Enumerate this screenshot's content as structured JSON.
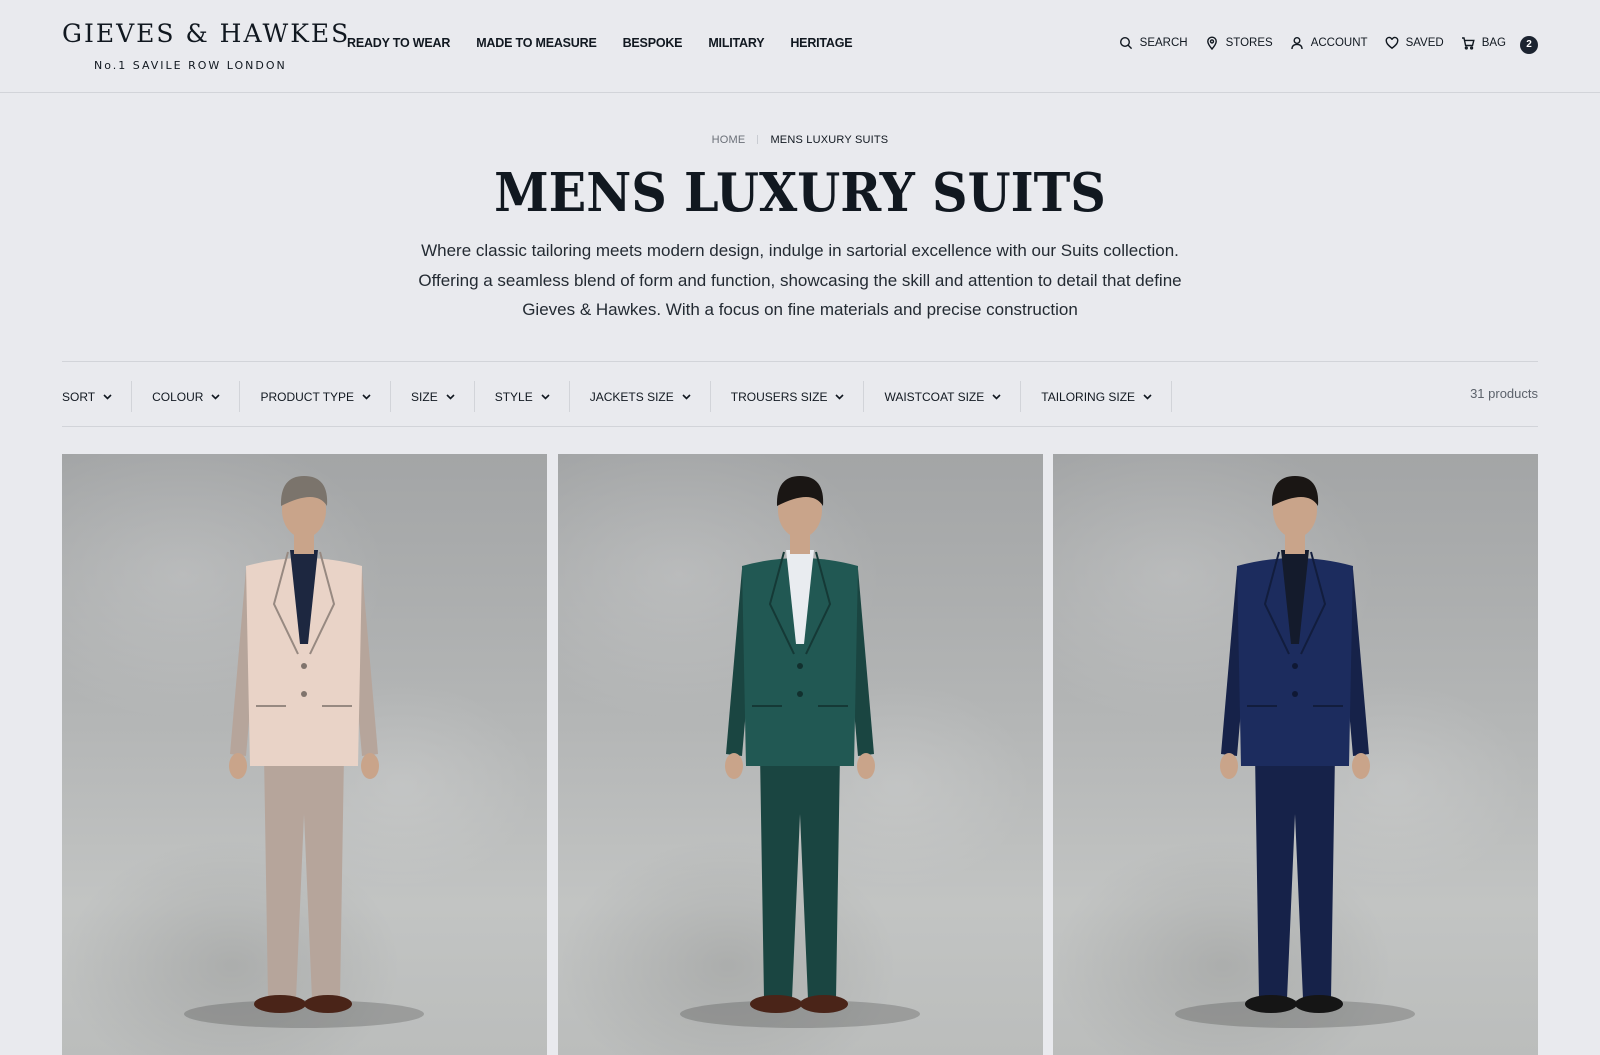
{
  "header": {
    "logo_main": "GIEVES & HAWKES",
    "logo_sub": "No.1 SAVILE ROW LONDON",
    "nav": [
      {
        "label": "READY TO WEAR"
      },
      {
        "label": "MADE TO MEASURE"
      },
      {
        "label": "BESPOKE"
      },
      {
        "label": "MILITARY"
      },
      {
        "label": "HERITAGE"
      }
    ],
    "utility": {
      "search": {
        "label": "SEARCH",
        "icon": "search-icon"
      },
      "stores": {
        "label": "STORES",
        "icon": "location-pin-icon"
      },
      "account": {
        "label": "ACCOUNT",
        "icon": "user-icon"
      },
      "saved": {
        "label": "SAVED",
        "icon": "heart-icon"
      },
      "bag": {
        "label": "BAG",
        "icon": "cart-icon",
        "count": "2"
      }
    }
  },
  "breadcrumb": {
    "home": "HOME",
    "current": "MENS LUXURY SUITS"
  },
  "page": {
    "title": "MENS LUXURY SUITS",
    "intro_lines": [
      "Where classic tailoring meets modern design, indulge in sartorial excellence with our Suits collection.",
      "Offering a seamless blend of form and function, showcasing the skill and attention to detail that define",
      "Gieves & Hawkes. With a focus on fine materials and precise construction"
    ]
  },
  "filters": [
    {
      "label": "SORT"
    },
    {
      "label": "COLOUR"
    },
    {
      "label": "PRODUCT TYPE"
    },
    {
      "label": "SIZE"
    },
    {
      "label": "STYLE"
    },
    {
      "label": "JACKETS SIZE"
    },
    {
      "label": "TROUSERS SIZE"
    },
    {
      "label": "WAISTCOAT SIZE"
    },
    {
      "label": "TAILORING SIZE"
    }
  ],
  "product_count": "31 products",
  "products": [
    {
      "suit_color": "#e9d3c7",
      "shirt_color": "#1d2740",
      "hair_color": "#7b746c",
      "shoe_color": "#4a2418"
    },
    {
      "suit_color": "#215853",
      "shirt_color": "#e9ecf0",
      "hair_color": "#1a1614",
      "shoe_color": "#4a2418"
    },
    {
      "suit_color": "#1c2c5e",
      "shirt_color": "#141b2c",
      "hair_color": "#1a1614",
      "shoe_color": "#151515"
    }
  ],
  "colors": {
    "background": "#e9eaee",
    "text": "#111820",
    "badge": "#1c2430"
  }
}
